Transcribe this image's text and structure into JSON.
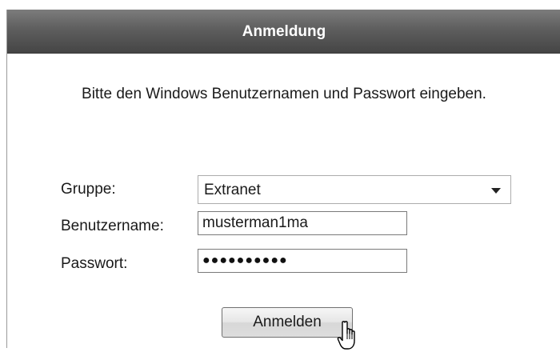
{
  "panel": {
    "title": "Anmeldung",
    "instructions": "Bitte den Windows Benutzernamen und Passwort eingeben."
  },
  "form": {
    "group": {
      "label": "Gruppe:",
      "selected": "Extranet"
    },
    "username": {
      "label": "Benutzername:",
      "value": "musterman1ma"
    },
    "password": {
      "label": "Passwort:",
      "masked_value": "●●●●●●●●●●"
    },
    "submit_label": "Anmelden"
  },
  "icons": {
    "select_arrow": "chevron-down-icon",
    "cursor": "hand-pointer-icon"
  },
  "colors": {
    "header_top": "#7c7c7c",
    "header_bottom": "#454545",
    "header_text": "#ffffff"
  }
}
